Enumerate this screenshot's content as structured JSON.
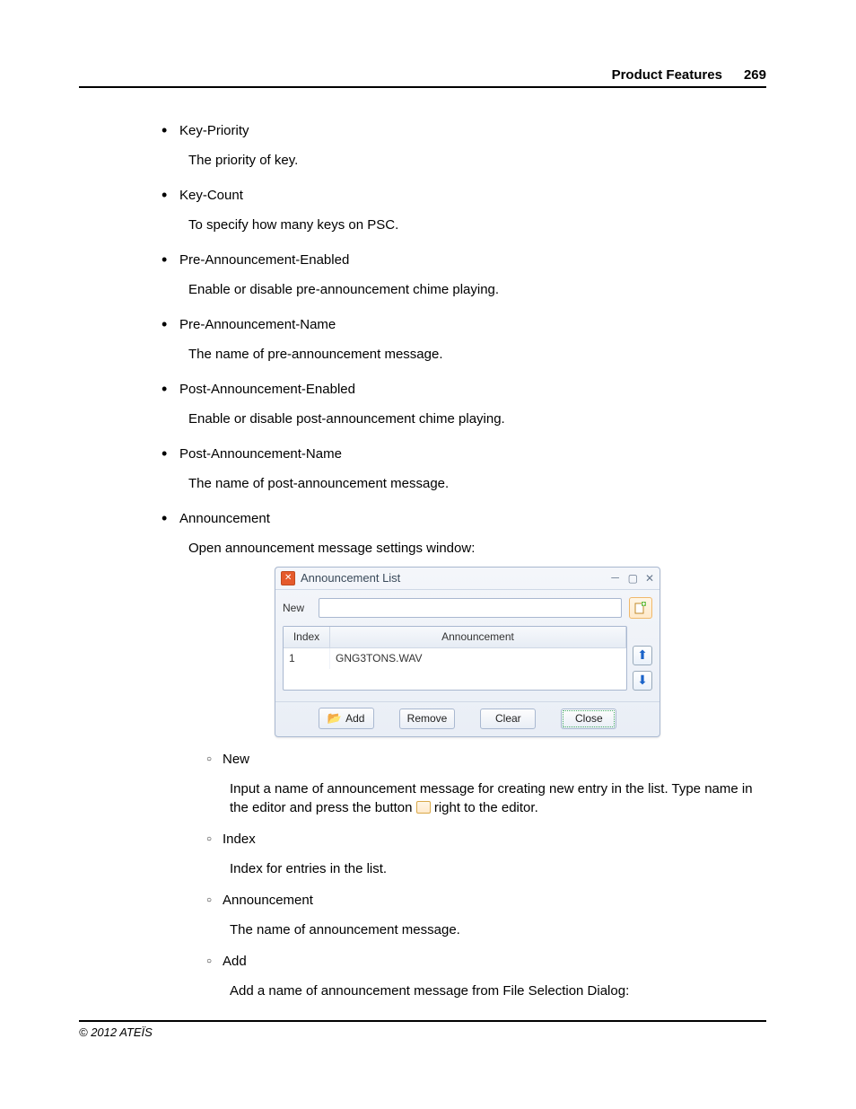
{
  "header": {
    "section": "Product Features",
    "page": "269"
  },
  "bullets": [
    {
      "term": "Key-Priority",
      "desc": "The priority of key."
    },
    {
      "term": "Key-Count",
      "desc": "To specify how many keys on PSC."
    },
    {
      "term": "Pre-Announcement-Enabled",
      "desc": "Enable or disable pre-announcement chime playing."
    },
    {
      "term": "Pre-Announcement-Name",
      "desc": "The name of pre-announcement message."
    },
    {
      "term": "Post-Announcement-Enabled",
      "desc": "Enable or disable post-announcement chime playing."
    },
    {
      "term": "Post-Announcement-Name",
      "desc": "The name of post-announcement message."
    },
    {
      "term": "Announcement",
      "desc": "Open announcement message settings window:"
    }
  ],
  "dialog": {
    "title": "Announcement List",
    "new_label": "New",
    "headers": {
      "index": "Index",
      "announcement": "Announcement"
    },
    "rows": [
      {
        "index": "1",
        "announcement": "GNG3TONS.WAV"
      }
    ],
    "buttons": {
      "add": "Add",
      "remove": "Remove",
      "clear": "Clear",
      "close": "Close"
    }
  },
  "sub": [
    {
      "term": "New",
      "desc_a": "Input a name of announcement message for creating new entry in the list. Type name in the editor and press the button ",
      "desc_b": " right to the editor."
    },
    {
      "term": "Index",
      "desc": "Index for entries in the list."
    },
    {
      "term": "Announcement",
      "desc": "The name of announcement message."
    },
    {
      "term": "Add",
      "desc": "Add a name of announcement message from File Selection Dialog:"
    }
  ],
  "footer": "© 2012 ATEÏS"
}
